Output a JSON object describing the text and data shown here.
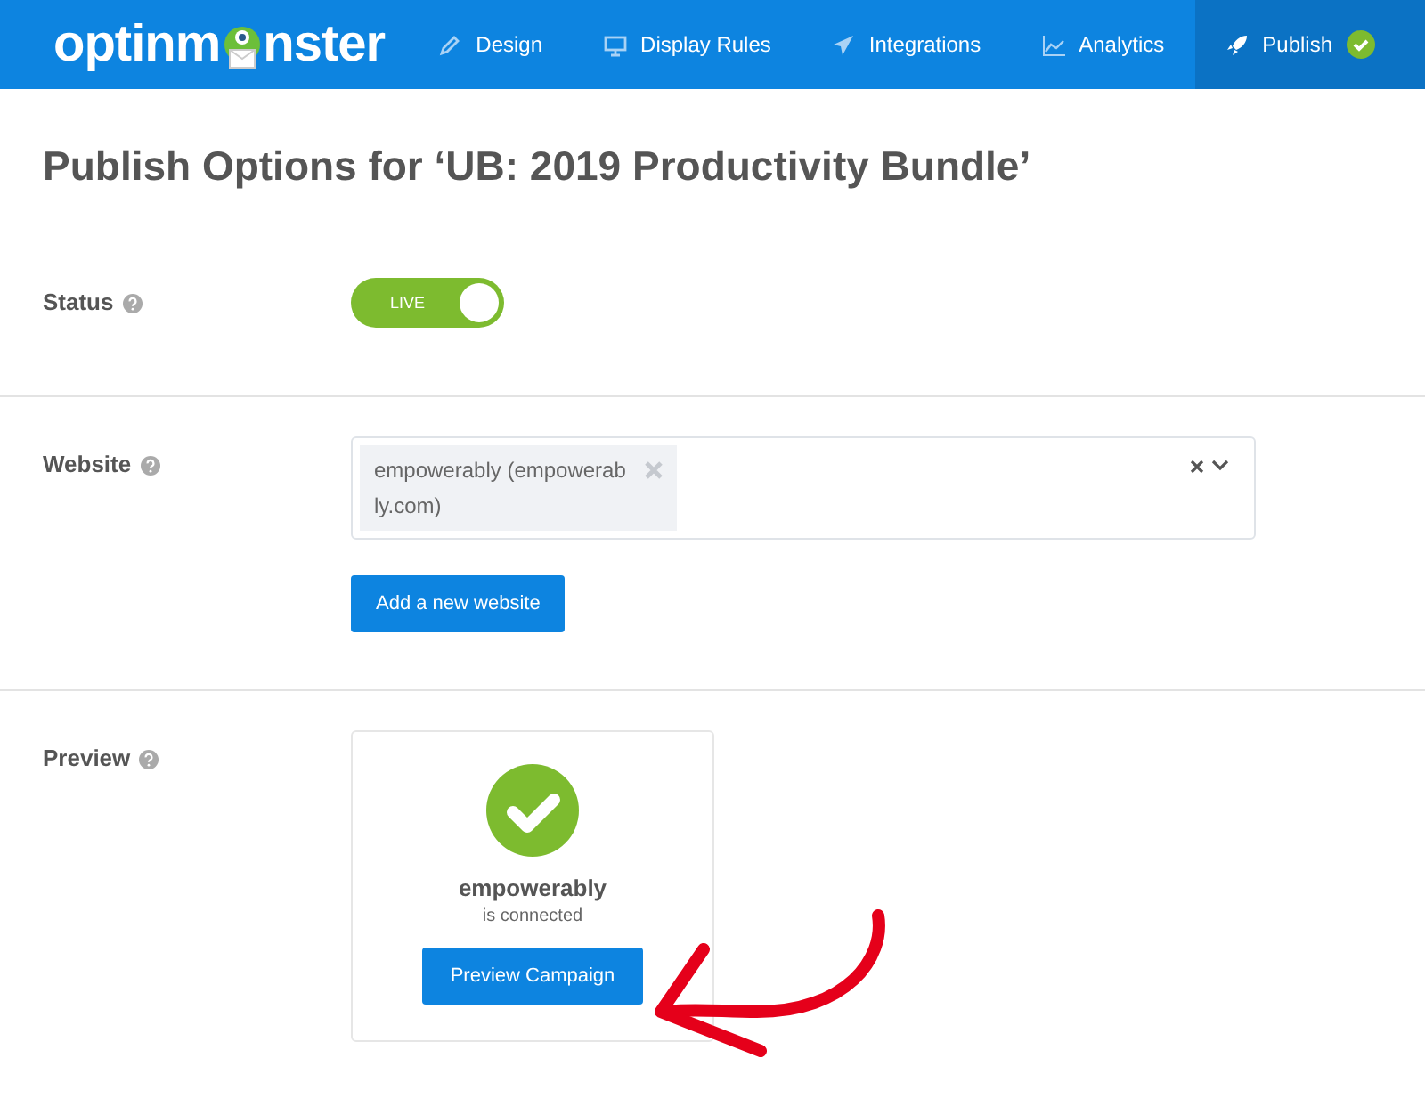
{
  "logo": {
    "before": "optinm",
    "after": "nster"
  },
  "nav": [
    {
      "label": "Design",
      "selected": false
    },
    {
      "label": "Display Rules",
      "selected": false
    },
    {
      "label": "Integrations",
      "selected": false
    },
    {
      "label": "Analytics",
      "selected": false
    },
    {
      "label": "Publish",
      "selected": true,
      "done": true
    }
  ],
  "title": "Publish Options for ‘UB: 2019 Productivity Bundle’",
  "status": {
    "label": "Status",
    "on": true,
    "toggle_text": "LIVE"
  },
  "website": {
    "label": "Website",
    "tags": [
      "empowerably (empowerab ly.com)"
    ],
    "button": "Add a new website"
  },
  "preview": {
    "label": "Preview",
    "site": "empowerably",
    "note": "is connected",
    "button": "Preview Campaign"
  }
}
